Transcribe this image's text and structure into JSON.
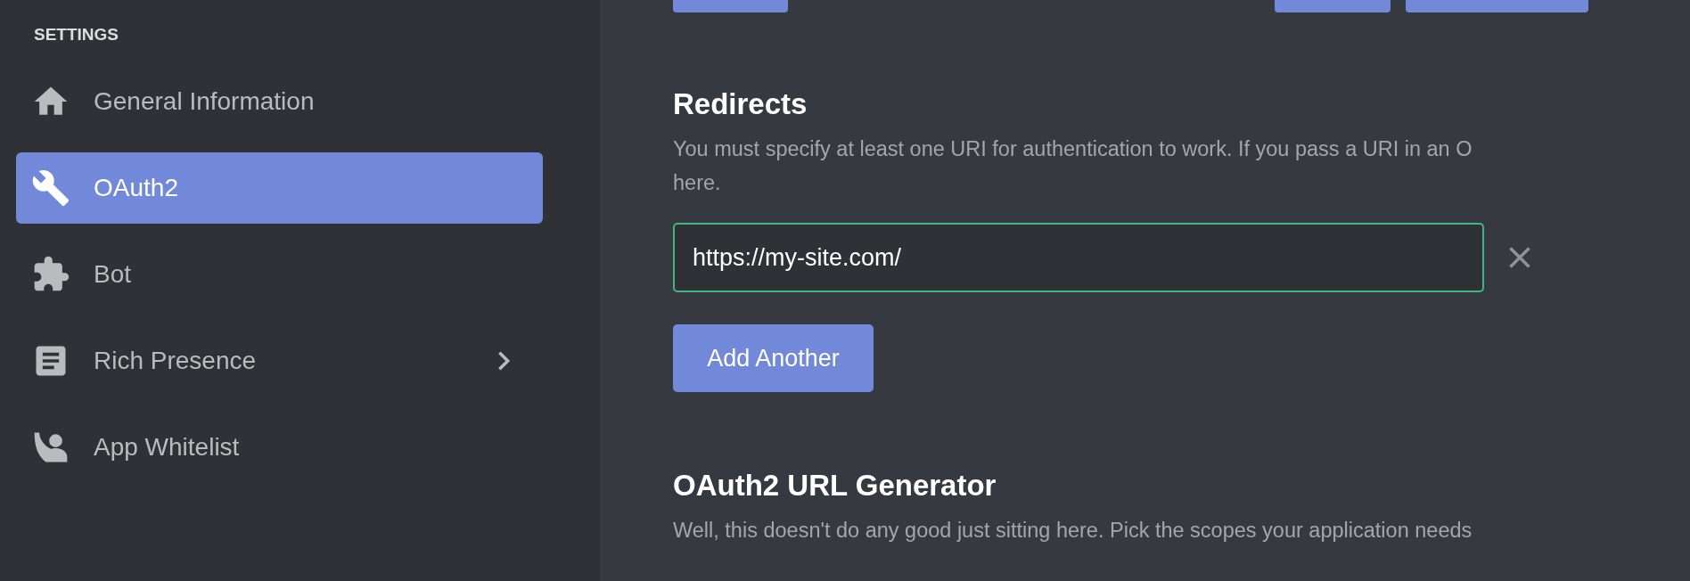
{
  "sidebar": {
    "heading": "SETTINGS",
    "items": [
      {
        "label": "General Information",
        "selected": false,
        "expandable": false
      },
      {
        "label": "OAuth2",
        "selected": true,
        "expandable": false
      },
      {
        "label": "Bot",
        "selected": false,
        "expandable": false
      },
      {
        "label": "Rich Presence",
        "selected": false,
        "expandable": true
      },
      {
        "label": "App Whitelist",
        "selected": false,
        "expandable": false
      }
    ]
  },
  "redirects": {
    "title": "Redirects",
    "description": "You must specify at least one URI for authentication to work. If you pass a URI in an O",
    "description_line_2": "here.",
    "uris": [
      {
        "value": "https://my-site.com/",
        "valid": true
      }
    ],
    "add_button": "Add Another"
  },
  "url_generator": {
    "title": "OAuth2 URL Generator",
    "description": "Well, this doesn't do any good just sitting here. Pick the scopes your application needs"
  }
}
